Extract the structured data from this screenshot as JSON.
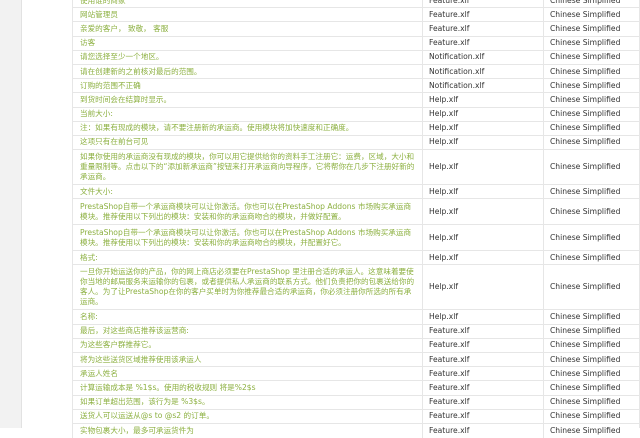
{
  "colors": {
    "source_text": "#8cb040",
    "cell_text": "#333333",
    "border": "#e6e6e6"
  },
  "rows": [
    {
      "source": "使用谁的商家",
      "file": "Feature.xlf",
      "lang": "Chinese Simplified"
    },
    {
      "source": "网站管理员",
      "file": "Feature.xlf",
      "lang": "Chinese Simplified"
    },
    {
      "source": "亲爱的客户， 致敬， 客服",
      "file": "Feature.xlf",
      "lang": "Chinese Simplified"
    },
    {
      "source": "访客",
      "file": "Feature.xlf",
      "lang": "Chinese Simplified"
    },
    {
      "source": "请您选择至少一个地区。",
      "file": "Notification.xlf",
      "lang": "Chinese Simplified"
    },
    {
      "source": "请在创建新的之前核对最后的范围。",
      "file": "Notification.xlf",
      "lang": "Chinese Simplified"
    },
    {
      "source": "订购的范围不正确",
      "file": "Notification.xlf",
      "lang": "Chinese Simplified"
    },
    {
      "source": "到货时间会在结算时显示。",
      "file": "Help.xlf",
      "lang": "Chinese Simplified"
    },
    {
      "source": "当前大小:",
      "file": "Help.xlf",
      "lang": "Chinese Simplified"
    },
    {
      "source": "注：如果有现成的模块，请不要注册新的承运商。使用模块将加快速度和正确度。",
      "file": "Help.xlf",
      "lang": "Chinese Simplified"
    },
    {
      "source": "这项只有在前台可见",
      "file": "Help.xlf",
      "lang": "Chinese Simplified"
    },
    {
      "source": "如果你使用的承运商没有现成的模块，你可以用它提供给你的资料手工注册它：运费，区域，大小和重量限制等。点击以下的“添加新承运商”按钮来打开承运商向导程序，它将帮你在几步下注册好新的承运商。",
      "file": "Help.xlf",
      "lang": "Chinese Simplified",
      "tall": true
    },
    {
      "source": "文件大小:",
      "file": "Help.xlf",
      "lang": "Chinese Simplified"
    },
    {
      "source": "PrestaShop自带一个承运商模块可以让你激活。你也可以在PrestaShop Addons 市场购买承运商模块。推荐使用以下列出的模块：安装和你的承运商吻合的模块，并做好配置。",
      "file": "Help.xlf",
      "lang": "Chinese Simplified",
      "tall": true
    },
    {
      "source": "PrestaShop自带一个承运商模块可以让你激活。你也可以在PrestaShop Addons 市场购买承运商模块。推荐使用以下列出的模块：安装和你的承运商吻合的模块，并配置好它。",
      "file": "Help.xlf",
      "lang": "Chinese Simplified",
      "tall": true
    },
    {
      "source": "格式:",
      "file": "Help.xlf",
      "lang": "Chinese Simplified"
    },
    {
      "source": "一旦你开始运送你的产品，你的网上商店必须要在PrestaShop 里注册合适的承运人。这意味着要使你当地的邮局服务来运输你的包裹，或者提供私人承运商的联系方式。他们负责把你的包裹送给你的客人。为了让PrestaShop在你的客户买单时为你推荐最合适的承运商，你必须注册你所选的所有承运商。",
      "file": "Help.xlf",
      "lang": "Chinese Simplified",
      "tall3": true
    },
    {
      "source": "名称:",
      "file": "Help.xlf",
      "lang": "Chinese Simplified"
    },
    {
      "source": "最后，对这些商店推荐该运营商:",
      "file": "Feature.xlf",
      "lang": "Chinese Simplified"
    },
    {
      "source": "为这些客户群推荐它。",
      "file": "Feature.xlf",
      "lang": "Chinese Simplified"
    },
    {
      "source": "将为这些送货区域推荐使用该承运人",
      "file": "Feature.xlf",
      "lang": "Chinese Simplified"
    },
    {
      "source": "承运人姓名",
      "file": "Feature.xlf",
      "lang": "Chinese Simplified"
    },
    {
      "source": "计算运输成本是 %1$s。使用的税收规则 将是%2$s",
      "file": "Feature.xlf",
      "lang": "Chinese Simplified"
    },
    {
      "source": "如果订单超出范围，该行为是 %3$s。",
      "file": "Feature.xlf",
      "lang": "Chinese Simplified"
    },
    {
      "source": "送货人可以运送从@s to @s2 的订单。",
      "file": "Feature.xlf",
      "lang": "Chinese Simplified"
    },
    {
      "source": "实物包裹大小，最多可承运货件为",
      "file": "Feature.xlf",
      "lang": "Chinese Simplified"
    }
  ]
}
